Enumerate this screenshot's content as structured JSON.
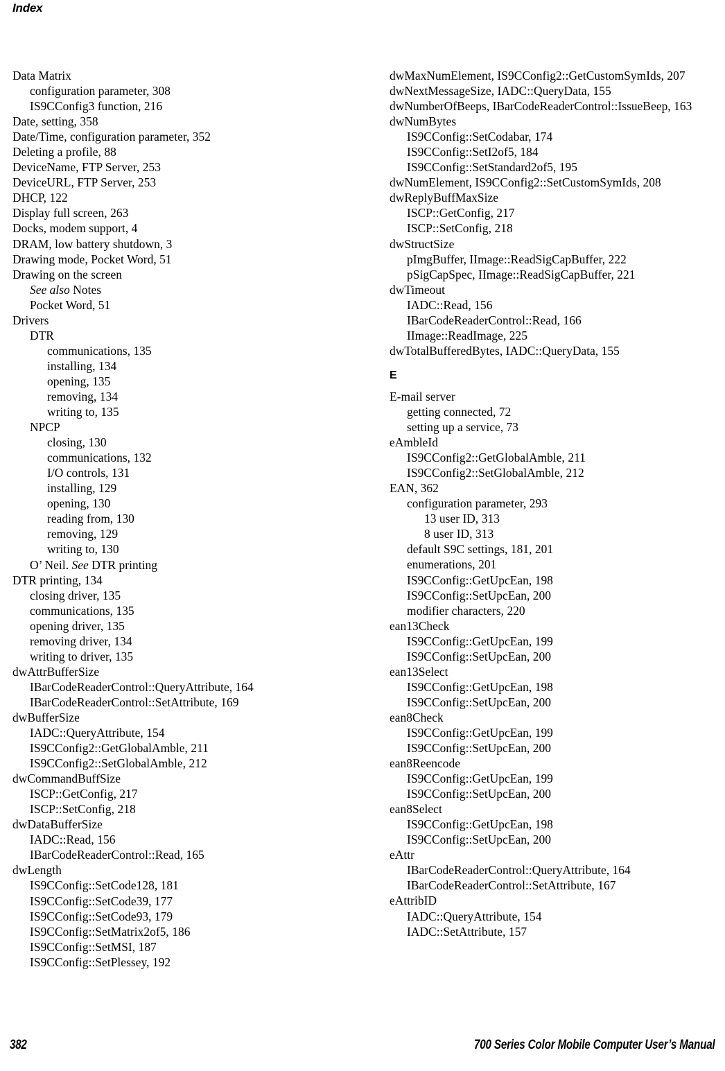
{
  "running_head": "Index",
  "footer": {
    "page_number": "382",
    "manual_title": "700 Series Color Mobile Computer User’s Manual"
  },
  "left_column": [
    {
      "level": 0,
      "text": "Data Matrix"
    },
    {
      "level": 1,
      "text": "configuration parameter, 308"
    },
    {
      "level": 1,
      "text": "IS9CConfig3 function, 216"
    },
    {
      "level": 0,
      "text": "Date, setting, 358"
    },
    {
      "level": 0,
      "text": "Date/Time, configuration parameter, 352"
    },
    {
      "level": 0,
      "text": "Deleting a profile, 88"
    },
    {
      "level": 0,
      "text": "DeviceName, FTP Server, 253"
    },
    {
      "level": 0,
      "text": "DeviceURL, FTP Server, 253"
    },
    {
      "level": 0,
      "text": "DHCP, 122"
    },
    {
      "level": 0,
      "text": "Display full screen, 263"
    },
    {
      "level": 0,
      "text": "Docks, modem support, 4"
    },
    {
      "level": 0,
      "text": "DRAM, low battery shutdown, 3"
    },
    {
      "level": 0,
      "text": "Drawing mode, Pocket Word, 51"
    },
    {
      "level": 0,
      "text": "Drawing on the screen"
    },
    {
      "level": 1,
      "text": "See also Notes",
      "italic_prefix": "See also",
      "italic_rest": " Notes"
    },
    {
      "level": 1,
      "text": "Pocket Word, 51"
    },
    {
      "level": 0,
      "text": "Drivers"
    },
    {
      "level": 1,
      "text": "DTR"
    },
    {
      "level": 2,
      "text": "communications, 135"
    },
    {
      "level": 2,
      "text": "installing, 134"
    },
    {
      "level": 2,
      "text": "opening, 135"
    },
    {
      "level": 2,
      "text": "removing, 134"
    },
    {
      "level": 2,
      "text": "writing to, 135"
    },
    {
      "level": 1,
      "text": "NPCP"
    },
    {
      "level": 2,
      "text": "closing, 130"
    },
    {
      "level": 2,
      "text": "communications, 132"
    },
    {
      "level": 2,
      "text": "I/O controls, 131"
    },
    {
      "level": 2,
      "text": "installing, 129"
    },
    {
      "level": 2,
      "text": "opening, 130"
    },
    {
      "level": 2,
      "text": "reading from, 130"
    },
    {
      "level": 2,
      "text": "removing, 129"
    },
    {
      "level": 2,
      "text": "writing to, 130"
    },
    {
      "level": 1,
      "text": "O’ Neil. See DTR printing",
      "italic_prefix": "O’ Neil. ",
      "italic_word": "See",
      "italic_rest": " DTR printing"
    },
    {
      "level": 0,
      "text": "DTR printing, 134"
    },
    {
      "level": 1,
      "text": "closing driver, 135"
    },
    {
      "level": 1,
      "text": "communications, 135"
    },
    {
      "level": 1,
      "text": "opening driver, 135"
    },
    {
      "level": 1,
      "text": "removing driver, 134"
    },
    {
      "level": 1,
      "text": "writing to driver, 135"
    },
    {
      "level": 0,
      "text": "dwAttrBufferSize"
    },
    {
      "level": 1,
      "text": "IBarCodeReaderControl::QueryAttribute, 164"
    },
    {
      "level": 1,
      "text": "IBarCodeReaderControl::SetAttribute, 169"
    },
    {
      "level": 0,
      "text": "dwBufferSize"
    },
    {
      "level": 1,
      "text": "IADC::QueryAttribute, 154"
    },
    {
      "level": 1,
      "text": "IS9CConfig2::GetGlobalAmble, 211"
    },
    {
      "level": 1,
      "text": "IS9CConfig2::SetGlobalAmble, 212"
    },
    {
      "level": 0,
      "text": "dwCommandBuffSize"
    },
    {
      "level": 1,
      "text": "ISCP::GetConfig, 217"
    },
    {
      "level": 1,
      "text": "ISCP::SetConfig, 218"
    },
    {
      "level": 0,
      "text": "dwDataBufferSize"
    },
    {
      "level": 1,
      "text": "IADC::Read, 156"
    },
    {
      "level": 1,
      "text": "IBarCodeReaderControl::Read, 165"
    },
    {
      "level": 0,
      "text": "dwLength"
    },
    {
      "level": 1,
      "text": "IS9CConfig::SetCode128, 181"
    },
    {
      "level": 1,
      "text": "IS9CConfig::SetCode39, 177"
    },
    {
      "level": 1,
      "text": "IS9CConfig::SetCode93, 179"
    },
    {
      "level": 1,
      "text": "IS9CConfig::SetMatrix2of5, 186"
    },
    {
      "level": 1,
      "text": "IS9CConfig::SetMSI, 187"
    },
    {
      "level": 1,
      "text": "IS9CConfig::SetPlessey, 192"
    }
  ],
  "right_column": [
    {
      "level": 0,
      "text": "dwMaxNumElement, IS9CConfig2::GetCustomSymIds, 207",
      "wrap": true
    },
    {
      "level": 0,
      "text": "dwNextMessageSize, IADC::QueryData, 155"
    },
    {
      "level": 0,
      "text": "dwNumberOfBeeps, IBarCodeReaderControl::IssueBeep, 163",
      "wrap": true
    },
    {
      "level": 0,
      "text": "dwNumBytes"
    },
    {
      "level": 1,
      "text": "IS9CConfig::SetCodabar, 174"
    },
    {
      "level": 1,
      "text": "IS9CConfig::SetI2of5, 184"
    },
    {
      "level": 1,
      "text": "IS9CConfig::SetStandard2of5, 195"
    },
    {
      "level": 0,
      "text": "dwNumElement, IS9CConfig2::SetCustomSymIds, 208"
    },
    {
      "level": 0,
      "text": "dwReplyBuffMaxSize"
    },
    {
      "level": 1,
      "text": "ISCP::GetConfig, 217"
    },
    {
      "level": 1,
      "text": "ISCP::SetConfig, 218"
    },
    {
      "level": 0,
      "text": "dwStructSize"
    },
    {
      "level": 1,
      "text": "pImgBuffer, IImage::ReadSigCapBuffer, 222"
    },
    {
      "level": 1,
      "text": "pSigCapSpec, IImage::ReadSigCapBuffer, 221"
    },
    {
      "level": 0,
      "text": "dwTimeout"
    },
    {
      "level": 1,
      "text": "IADC::Read, 156"
    },
    {
      "level": 1,
      "text": "IBarCodeReaderControl::Read, 166"
    },
    {
      "level": 1,
      "text": "IImage::ReadImage, 225"
    },
    {
      "level": 0,
      "text": "dwTotalBufferedBytes, IADC::QueryData, 155"
    },
    {
      "heading": "E"
    },
    {
      "level": 0,
      "text": "E-mail server"
    },
    {
      "level": 1,
      "text": "getting connected, 72"
    },
    {
      "level": 1,
      "text": "setting up a service, 73"
    },
    {
      "level": 0,
      "text": "eAmbleId"
    },
    {
      "level": 1,
      "text": "IS9CConfig2::GetGlobalAmble, 211"
    },
    {
      "level": 1,
      "text": "IS9CConfig2::SetGlobalAmble, 212"
    },
    {
      "level": 0,
      "text": "EAN, 362"
    },
    {
      "level": 1,
      "text": "configuration parameter, 293"
    },
    {
      "level": 2,
      "text": "13 user ID, 313"
    },
    {
      "level": 2,
      "text": "8 user ID, 313"
    },
    {
      "level": 1,
      "text": "default S9C settings, 181, 201"
    },
    {
      "level": 1,
      "text": "enumerations, 201"
    },
    {
      "level": 1,
      "text": "IS9CConfig::GetUpcEan, 198"
    },
    {
      "level": 1,
      "text": "IS9CConfig::SetUpcEan, 200"
    },
    {
      "level": 1,
      "text": "modifier characters, 220"
    },
    {
      "level": 0,
      "text": "ean13Check"
    },
    {
      "level": 1,
      "text": "IS9CConfig::GetUpcEan, 199"
    },
    {
      "level": 1,
      "text": "IS9CConfig::SetUpcEan, 200"
    },
    {
      "level": 0,
      "text": "ean13Select"
    },
    {
      "level": 1,
      "text": "IS9CConfig::GetUpcEan, 198"
    },
    {
      "level": 1,
      "text": "IS9CConfig::SetUpcEan, 200"
    },
    {
      "level": 0,
      "text": "ean8Check"
    },
    {
      "level": 1,
      "text": "IS9CConfig::GetUpcEan, 199"
    },
    {
      "level": 1,
      "text": "IS9CConfig::SetUpcEan, 200"
    },
    {
      "level": 0,
      "text": "ean8Reencode"
    },
    {
      "level": 1,
      "text": "IS9CConfig::GetUpcEan, 199"
    },
    {
      "level": 1,
      "text": "IS9CConfig::SetUpcEan, 200"
    },
    {
      "level": 0,
      "text": "ean8Select"
    },
    {
      "level": 1,
      "text": "IS9CConfig::GetUpcEan, 198"
    },
    {
      "level": 1,
      "text": "IS9CConfig::SetUpcEan, 200"
    },
    {
      "level": 0,
      "text": "eAttr"
    },
    {
      "level": 1,
      "text": "IBarCodeReaderControl::QueryAttribute, 164"
    },
    {
      "level": 1,
      "text": "IBarCodeReaderControl::SetAttribute, 167"
    },
    {
      "level": 0,
      "text": "eAttribID"
    },
    {
      "level": 1,
      "text": "IADC::QueryAttribute, 154"
    },
    {
      "level": 1,
      "text": "IADC::SetAttribute, 157"
    }
  ]
}
